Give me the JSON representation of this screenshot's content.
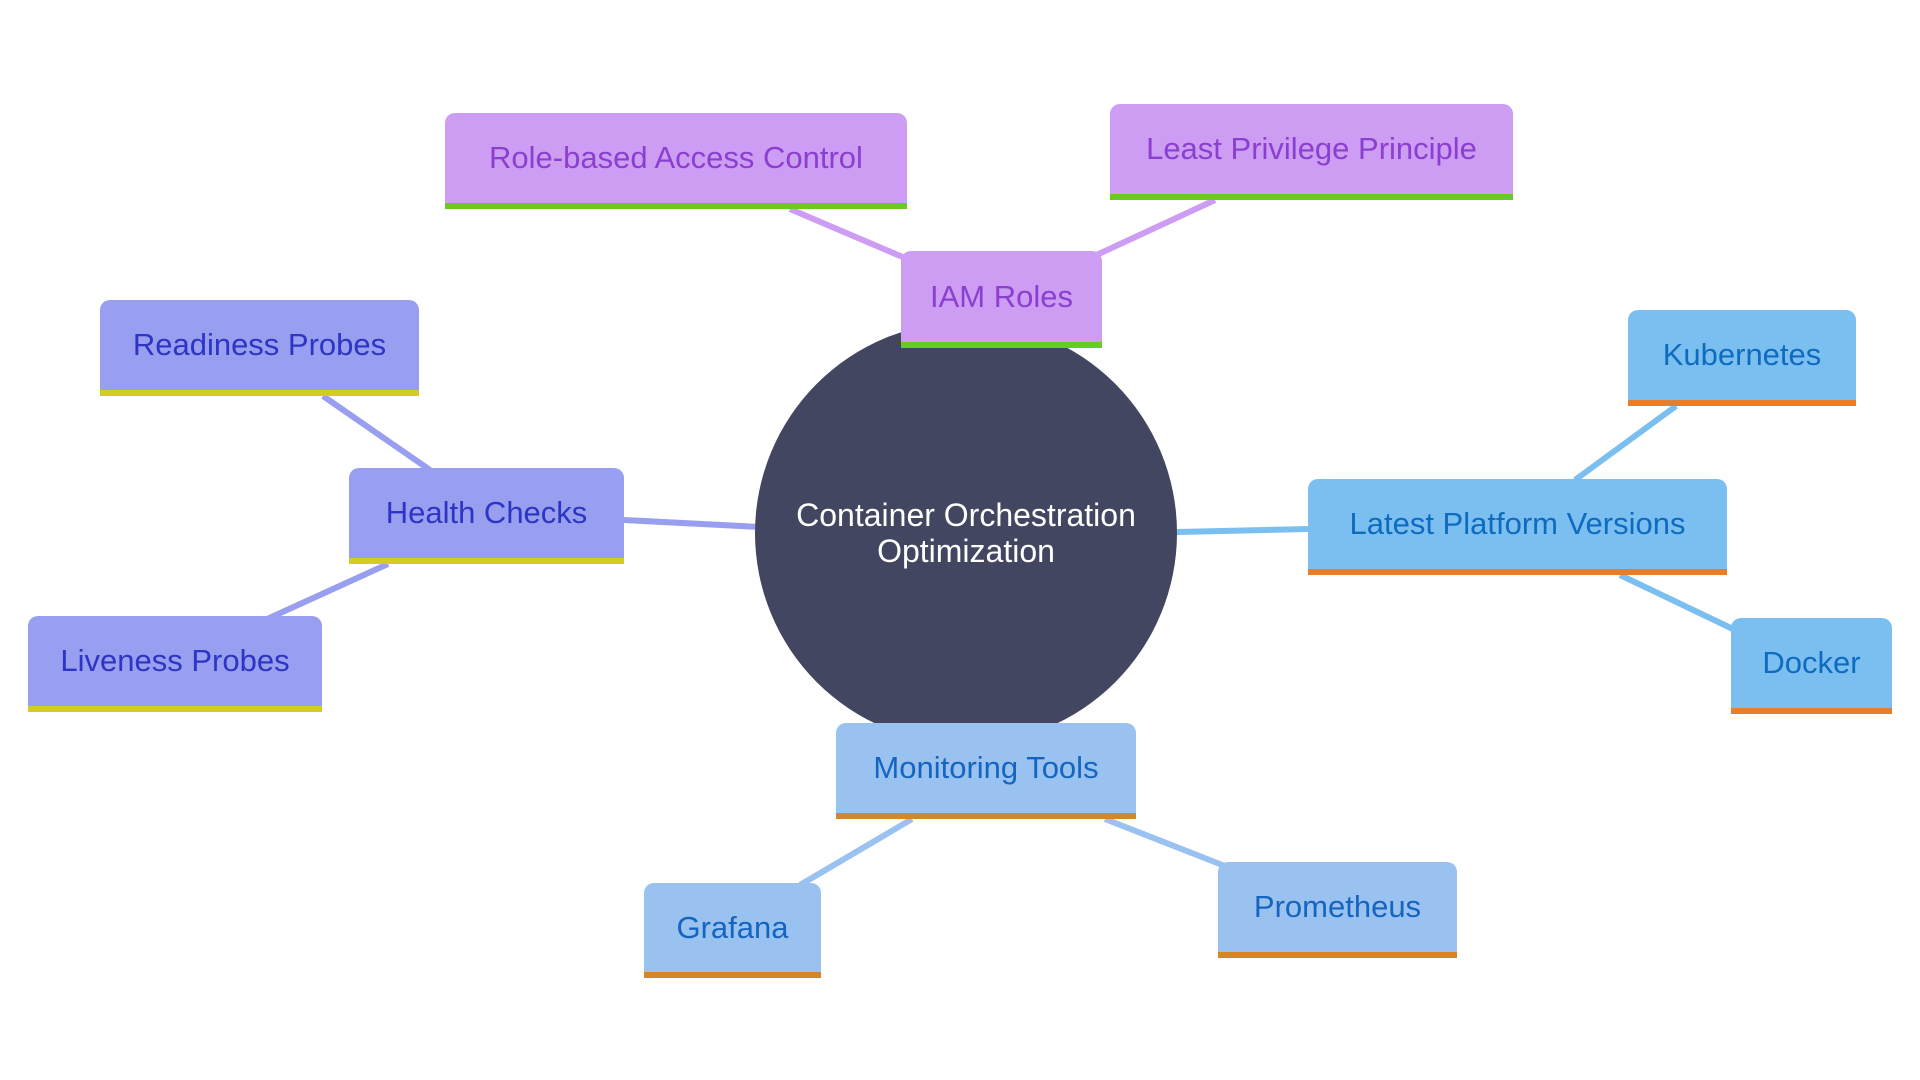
{
  "diagram": {
    "type": "mindmap",
    "root": {
      "label_line1": "Container Orchestration",
      "label_line2": "Optimization",
      "color": "#424660"
    },
    "branches": [
      {
        "id": "iam",
        "label": "IAM Roles",
        "color": "#cd9cf3",
        "accent": "#66cc22",
        "children": [
          {
            "label": "Role-based Access Control"
          },
          {
            "label": "Least Privilege Principle"
          }
        ]
      },
      {
        "id": "health",
        "label": "Health Checks",
        "color": "#989ef0",
        "accent": "#d4cc20",
        "children": [
          {
            "label": "Readiness Probes"
          },
          {
            "label": "Liveness Probes"
          }
        ]
      },
      {
        "id": "platform",
        "label": "Latest Platform Versions",
        "color": "#7bbff0",
        "accent": "#e67e2e",
        "children": [
          {
            "label": "Kubernetes"
          },
          {
            "label": "Docker"
          }
        ]
      },
      {
        "id": "monitoring",
        "label": "Monitoring Tools",
        "color": "#99c2f0",
        "accent": "#d4862a",
        "children": [
          {
            "label": "Grafana"
          },
          {
            "label": "Prometheus"
          }
        ]
      }
    ]
  }
}
